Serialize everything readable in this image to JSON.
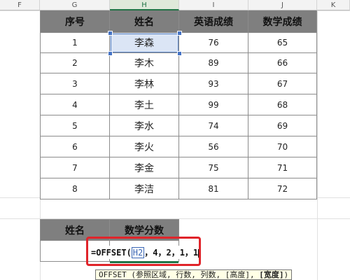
{
  "columns": [
    "F",
    "G",
    "H",
    "I",
    "J",
    "K"
  ],
  "table": {
    "headers": [
      "序号",
      "姓名",
      "英语成绩",
      "数学成绩"
    ],
    "rows": [
      [
        "1",
        "李森",
        "76",
        "65"
      ],
      [
        "2",
        "李木",
        "89",
        "66"
      ],
      [
        "3",
        "李林",
        "93",
        "67"
      ],
      [
        "4",
        "李土",
        "99",
        "68"
      ],
      [
        "5",
        "李水",
        "74",
        "69"
      ],
      [
        "6",
        "李火",
        "56",
        "70"
      ],
      [
        "7",
        "李金",
        "75",
        "71"
      ],
      [
        "8",
        "李洁",
        "81",
        "72"
      ]
    ]
  },
  "lookup": {
    "headers": [
      "姓名",
      "数学分数"
    ]
  },
  "formula": {
    "prefix": "=OFFSET(",
    "ref": "H2",
    "rest": "，4，2，1，1"
  },
  "tooltip": {
    "fn": "OFFSET",
    "args": "(参照区域, 行数, 列数, [高度],",
    "bold_arg": "[宽度]",
    "close": ")"
  },
  "colors": {
    "header_fill": "#7f7f7f",
    "highlight_box": "#e0242a",
    "selected_cell": "#dbe5f5",
    "reference": "#3c67b5"
  }
}
